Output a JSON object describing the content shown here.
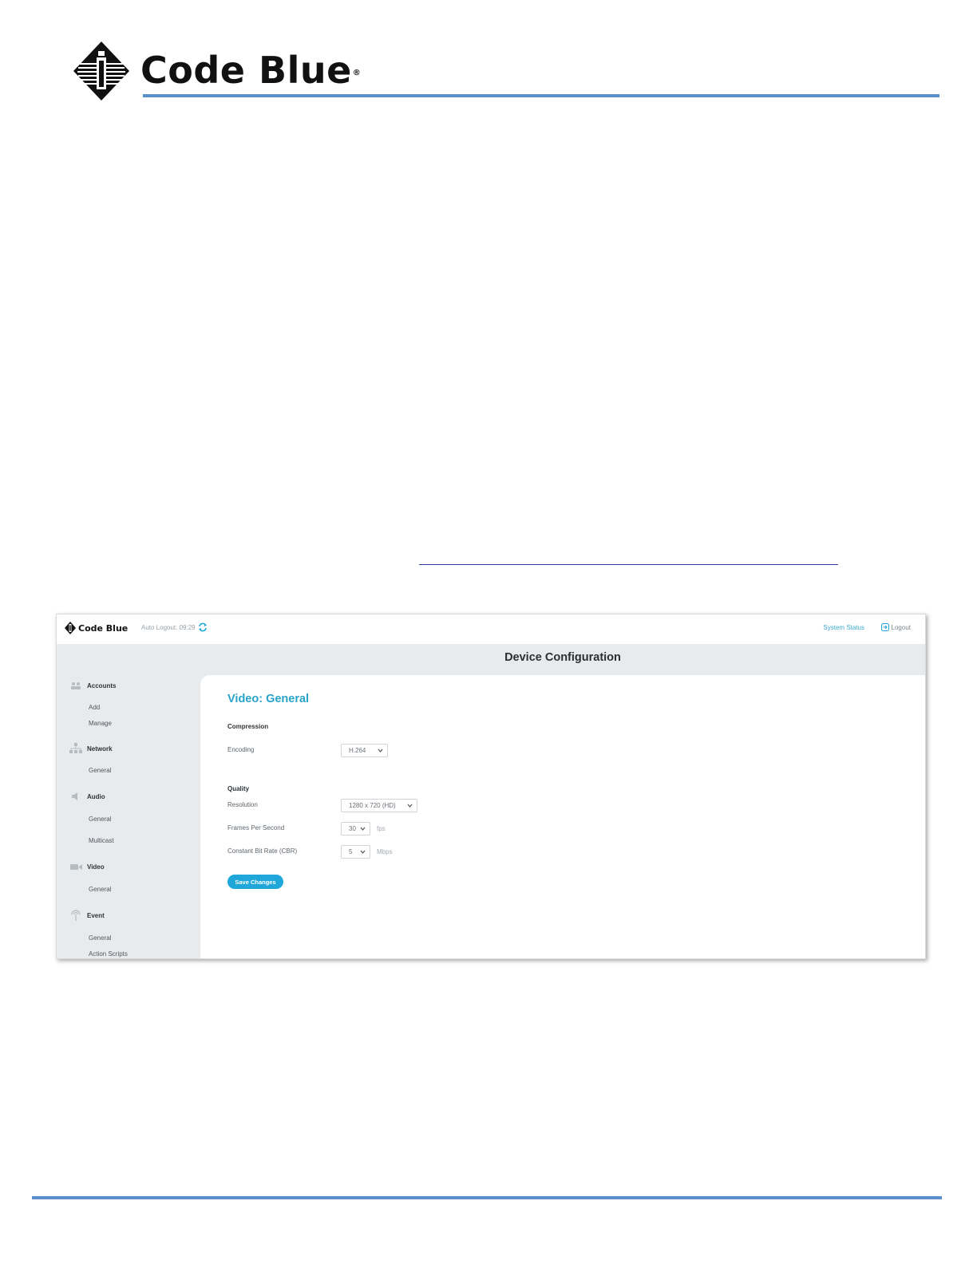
{
  "brand": {
    "name": "Code Blue",
    "registered": "®"
  },
  "app": {
    "auto_logout": "Auto Logout: 09:29",
    "system_status": "System Status",
    "logout": "Logout",
    "page_title": "Device Configuration"
  },
  "sidebar": {
    "sections": [
      {
        "label": "Accounts",
        "icon": "users-icon",
        "items": [
          "Add",
          "Manage"
        ]
      },
      {
        "label": "Network",
        "icon": "network-icon",
        "items": [
          "General"
        ]
      },
      {
        "label": "Audio",
        "icon": "speaker-icon",
        "items": [
          "General",
          "Multicast"
        ]
      },
      {
        "label": "Video",
        "icon": "video-camera-icon",
        "items": [
          "General"
        ]
      },
      {
        "label": "Event",
        "icon": "event-icon",
        "items": [
          "General",
          "Action Scripts"
        ]
      }
    ]
  },
  "main": {
    "title": "Video: General",
    "compression": {
      "heading": "Compression",
      "encoding_label": "Encoding",
      "encoding_value": "H.264"
    },
    "quality": {
      "heading": "Quality",
      "resolution_label": "Resolution",
      "resolution_value": "1280 x 720 (HD)",
      "fps_label": "Frames Per Second",
      "fps_value": "30",
      "fps_unit": "fps",
      "cbr_label": "Constant Bit Rate (CBR)",
      "cbr_value": "5",
      "cbr_unit": "Mbps"
    },
    "save_label": "Save Changes"
  },
  "colors": {
    "accent": "#1fa7d9",
    "title": "#2aa3c9",
    "rule": "#5b8fc9"
  }
}
